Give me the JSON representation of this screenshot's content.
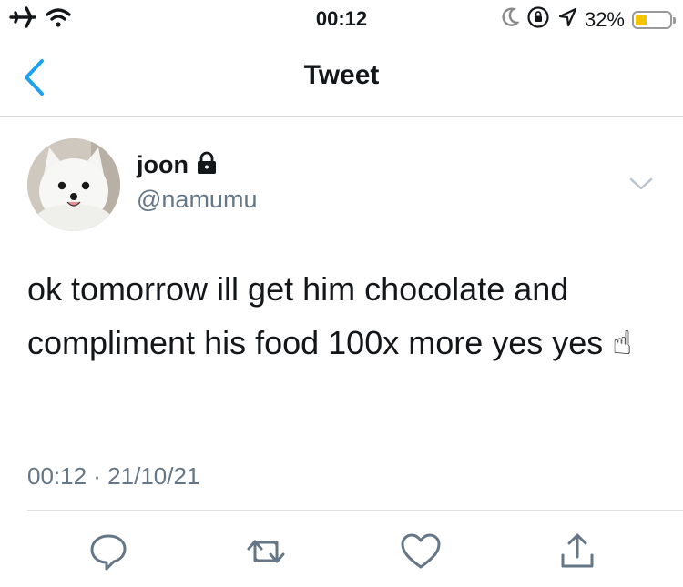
{
  "status_bar": {
    "time": "00:12",
    "battery_percent": "32%",
    "battery_level": 0.32,
    "icons": [
      "airplane-mode-icon",
      "wifi-icon",
      "moon-icon",
      "orientation-lock-icon",
      "location-arrow-icon",
      "battery-icon"
    ]
  },
  "nav": {
    "title": "Tweet",
    "back_icon": "chevron-left-icon"
  },
  "tweet": {
    "display_name": "joon",
    "protected_icon": "lock-icon",
    "handle": "@namumu",
    "text": "ok tomorrow ill get him chocolate and compliment his food 100x more yes yes ☝",
    "timestamp": "00:12 · 21/10/21",
    "menu_icon": "chevron-down-icon"
  },
  "actions": [
    "reply-icon",
    "retweet-icon",
    "like-icon",
    "share-icon"
  ],
  "colors": {
    "accent": "#1da1f2",
    "secondary_text": "#657786",
    "divider": "#e1e1e1",
    "battery_fill": "#f5c400"
  }
}
